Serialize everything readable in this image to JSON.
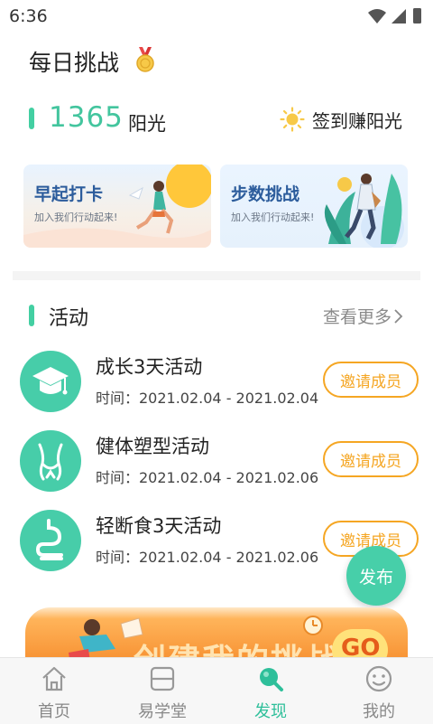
{
  "status_bar": {
    "time": "6:36"
  },
  "header": {
    "title": "每日挑战"
  },
  "sunshine": {
    "count": "1365",
    "unit": "阳光",
    "signin_label": "签到赚阳光"
  },
  "cards": [
    {
      "title": "早起打卡",
      "subtitle": "加入我们行动起来!"
    },
    {
      "title": "步数挑战",
      "subtitle": "加入我们行动起来!"
    }
  ],
  "activities": {
    "section_title": "活动",
    "more_label": "查看更多",
    "items": [
      {
        "name": "成长3天活动",
        "time": "时间：2021.02.04 - 2021.02.04",
        "action": "邀请成员",
        "icon": "graduation-cap-icon"
      },
      {
        "name": "健体塑型活动",
        "time": "时间：2021.02.04 - 2021.02.06",
        "action": "邀请成员",
        "icon": "body-shape-icon"
      },
      {
        "name": "轻断食3天活动",
        "time": "时间：2021.02.04 - 2021.02.06",
        "action": "邀请成员",
        "icon": "stomach-icon"
      }
    ]
  },
  "fab": {
    "label": "发布"
  },
  "banner": {
    "text": "创建我的挑战",
    "go": "GO"
  },
  "tabbar": [
    {
      "label": "首页",
      "icon": "home-icon"
    },
    {
      "label": "易学堂",
      "icon": "classroom-icon"
    },
    {
      "label": "发现",
      "icon": "discover-search-icon",
      "active": true
    },
    {
      "label": "我的",
      "icon": "profile-face-icon"
    }
  ],
  "colors": {
    "accent": "#43cfa2",
    "invite": "#f5a623",
    "active_tab": "#2ebf9a"
  }
}
